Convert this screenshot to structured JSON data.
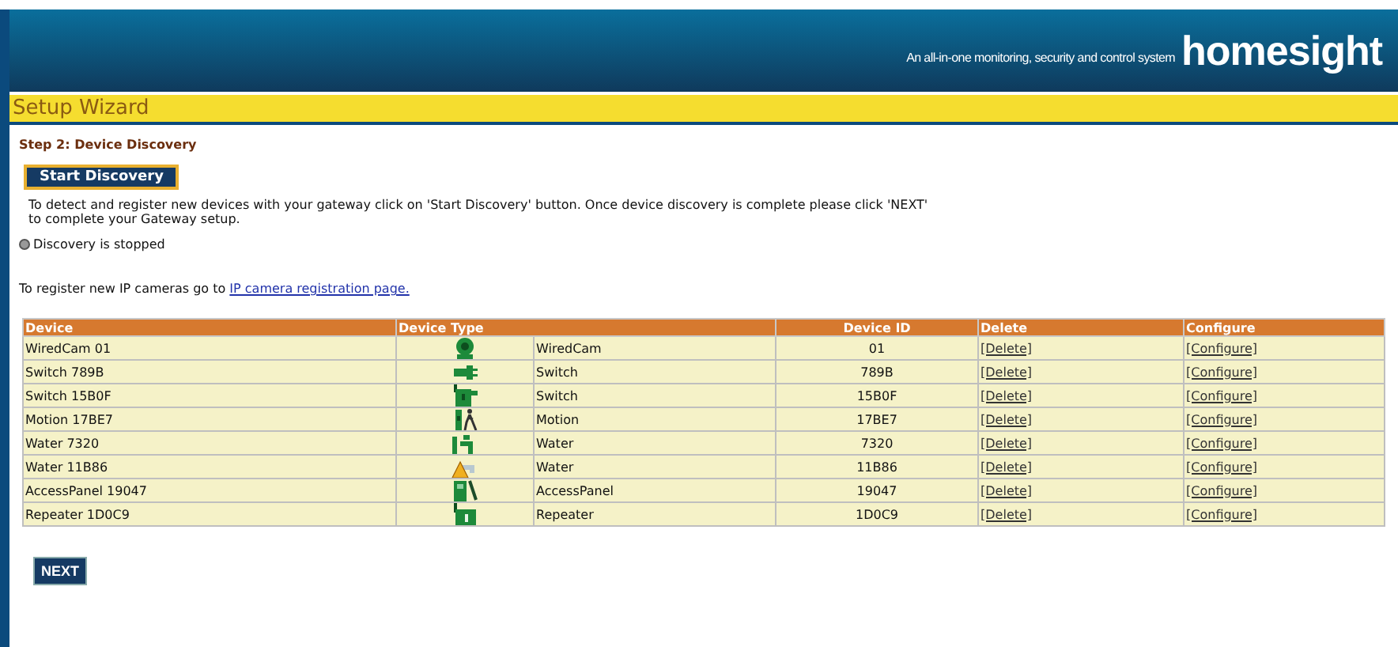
{
  "header": {
    "tagline": "An all-in-one monitoring, security and control system",
    "logo": "homesight"
  },
  "wizard": {
    "title": "Setup Wizard",
    "step": "Step 2: Device Discovery"
  },
  "start_button": "Start Discovery",
  "instructions": "To detect and register new devices with your gateway click on 'Start Discovery' button. Once device discovery is complete please click 'NEXT'\nto complete your Gateway setup.",
  "discovery": {
    "running": false,
    "status": "Discovery is stopped"
  },
  "ip_camera": {
    "text": "To register new IP cameras go to",
    "link": "IP camera registration page."
  },
  "table": {
    "columns": [
      "Device",
      "Device Type",
      "Device ID",
      "Delete",
      "Configure"
    ],
    "rows": [
      {
        "device": "WiredCam 01",
        "kind": "camera",
        "type": "WiredCam",
        "id": "01",
        "delete": "[Delete]",
        "configure": "[Configure]"
      },
      {
        "device": "Switch 789B",
        "kind": "plug",
        "type": "Switch",
        "id": "789B",
        "delete": "[Delete]",
        "configure": "[Configure]"
      },
      {
        "device": "Switch 15B0F",
        "kind": "switch",
        "type": "Switch",
        "id": "15B0F",
        "delete": "[Delete]",
        "configure": "[Configure]"
      },
      {
        "device": "Motion 17BE7",
        "kind": "motion",
        "type": "Motion",
        "id": "17BE7",
        "delete": "[Delete]",
        "configure": "[Configure]"
      },
      {
        "device": "Water 7320",
        "kind": "water",
        "type": "Water",
        "id": "7320",
        "delete": "[Delete]",
        "configure": "[Configure]"
      },
      {
        "device": "Water 11B86",
        "kind": "water-alert",
        "type": "Water",
        "id": "11B86",
        "delete": "[Delete]",
        "configure": "[Configure]"
      },
      {
        "device": "AccessPanel 19047",
        "kind": "panel",
        "type": "AccessPanel",
        "id": "19047",
        "delete": "[Delete]",
        "configure": "[Configure]"
      },
      {
        "device": "Repeater 1D0C9",
        "kind": "repeater",
        "type": "Repeater",
        "id": "1D0C9",
        "delete": "[Delete]",
        "configure": "[Configure]"
      }
    ]
  },
  "next_button": "NEXT"
}
